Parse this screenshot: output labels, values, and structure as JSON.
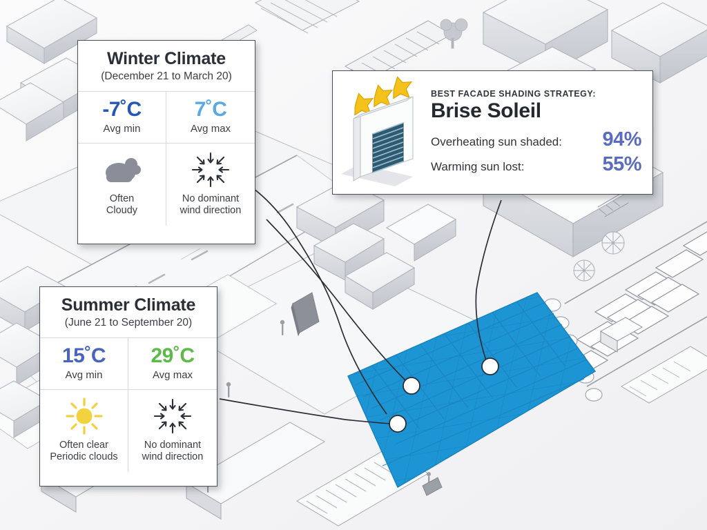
{
  "scene": {
    "background_name": "axonometric-city-model",
    "site_color": "#1d95d4",
    "site_label": "highlighted-site-plot"
  },
  "winter": {
    "title": "Winter Climate",
    "period": "(December 21 to March 20)",
    "min": {
      "value": "-7˚C",
      "label": "Avg min",
      "color": "#2457b6"
    },
    "max": {
      "value": "7˚C",
      "label": "Avg max",
      "color": "#59a9e2"
    },
    "sky": {
      "icon": "cloudy-icon",
      "caption_1": "Often",
      "caption_2": "Cloudy",
      "color": "#8a8e99"
    },
    "wind": {
      "icon": "no-dominant-wind-icon",
      "caption_1": "No dominant",
      "caption_2": "wind direction"
    }
  },
  "summer": {
    "title": "Summer Climate",
    "period": "(June 21 to September 20)",
    "min": {
      "value": "15˚C",
      "label": "Avg min",
      "color": "#4a63c0"
    },
    "max": {
      "value": "29˚C",
      "label": "Avg max",
      "color": "#5cba46"
    },
    "sky": {
      "icon": "sunny-icon",
      "caption_1": "Often clear",
      "caption_2": "Periodic clouds",
      "color": "#f2cf3f"
    },
    "wind": {
      "icon": "no-dominant-wind-icon",
      "caption_1": "No dominant",
      "caption_2": "wind direction"
    }
  },
  "strategy": {
    "kicker": "BEST FACADE SHADING STRATEGY:",
    "name": "Brise Soleil",
    "rating_stars": 3,
    "illustration": "brise-soleil-louver-panel-icon",
    "metrics": [
      {
        "label": "Overheating sun shaded:",
        "value": "94%"
      },
      {
        "label": "Warming sun lost:",
        "value": "55%"
      }
    ],
    "accent_color": "#5a6cbe",
    "star_color": "#f5c21c"
  },
  "markers": [
    {
      "name": "site-marker-1"
    },
    {
      "name": "site-marker-2"
    },
    {
      "name": "site-marker-3"
    }
  ]
}
